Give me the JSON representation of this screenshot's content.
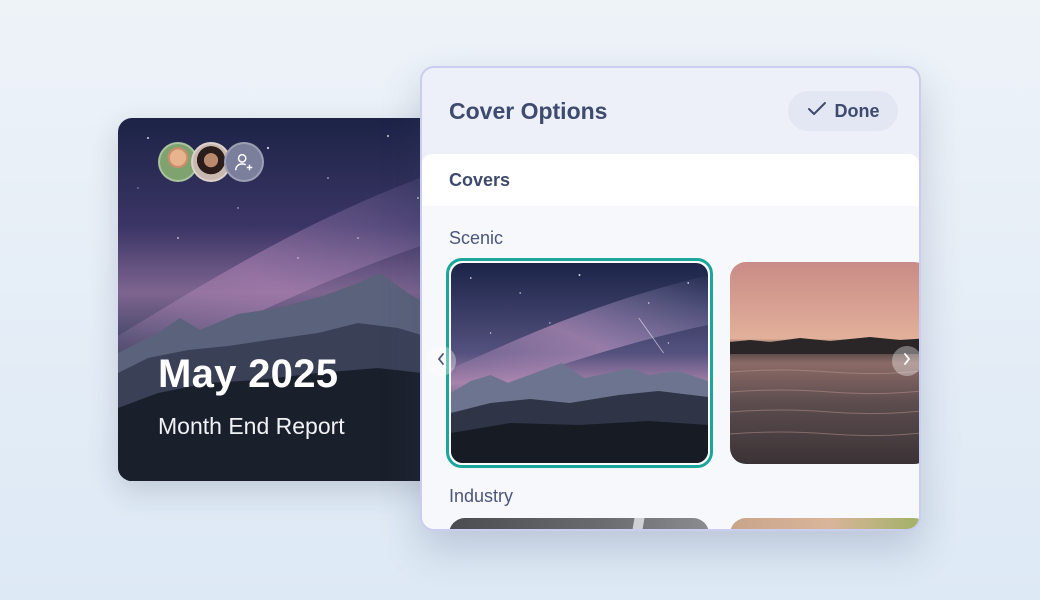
{
  "report": {
    "title": "May 2025",
    "subtitle": "Month End Report",
    "avatars": [
      "avatar-person-1",
      "avatar-person-2",
      "add-person-icon"
    ]
  },
  "panel": {
    "title": "Cover Options",
    "done_label": "Done",
    "tab_label": "Covers",
    "sections": [
      {
        "label": "Scenic",
        "thumbnails": [
          "night-mountains",
          "sunset-lake"
        ],
        "selected": "night-mountains"
      },
      {
        "label": "Industry",
        "thumbnails": [
          "industry-1",
          "industry-2"
        ]
      }
    ]
  },
  "colors": {
    "accent_selected": "#1aa69a",
    "panel_border": "#c9cdf0",
    "heading_text": "#3e4a6e"
  },
  "icons": {
    "done": "check-icon",
    "prev": "chevron-left-icon",
    "next": "chevron-right-icon"
  }
}
